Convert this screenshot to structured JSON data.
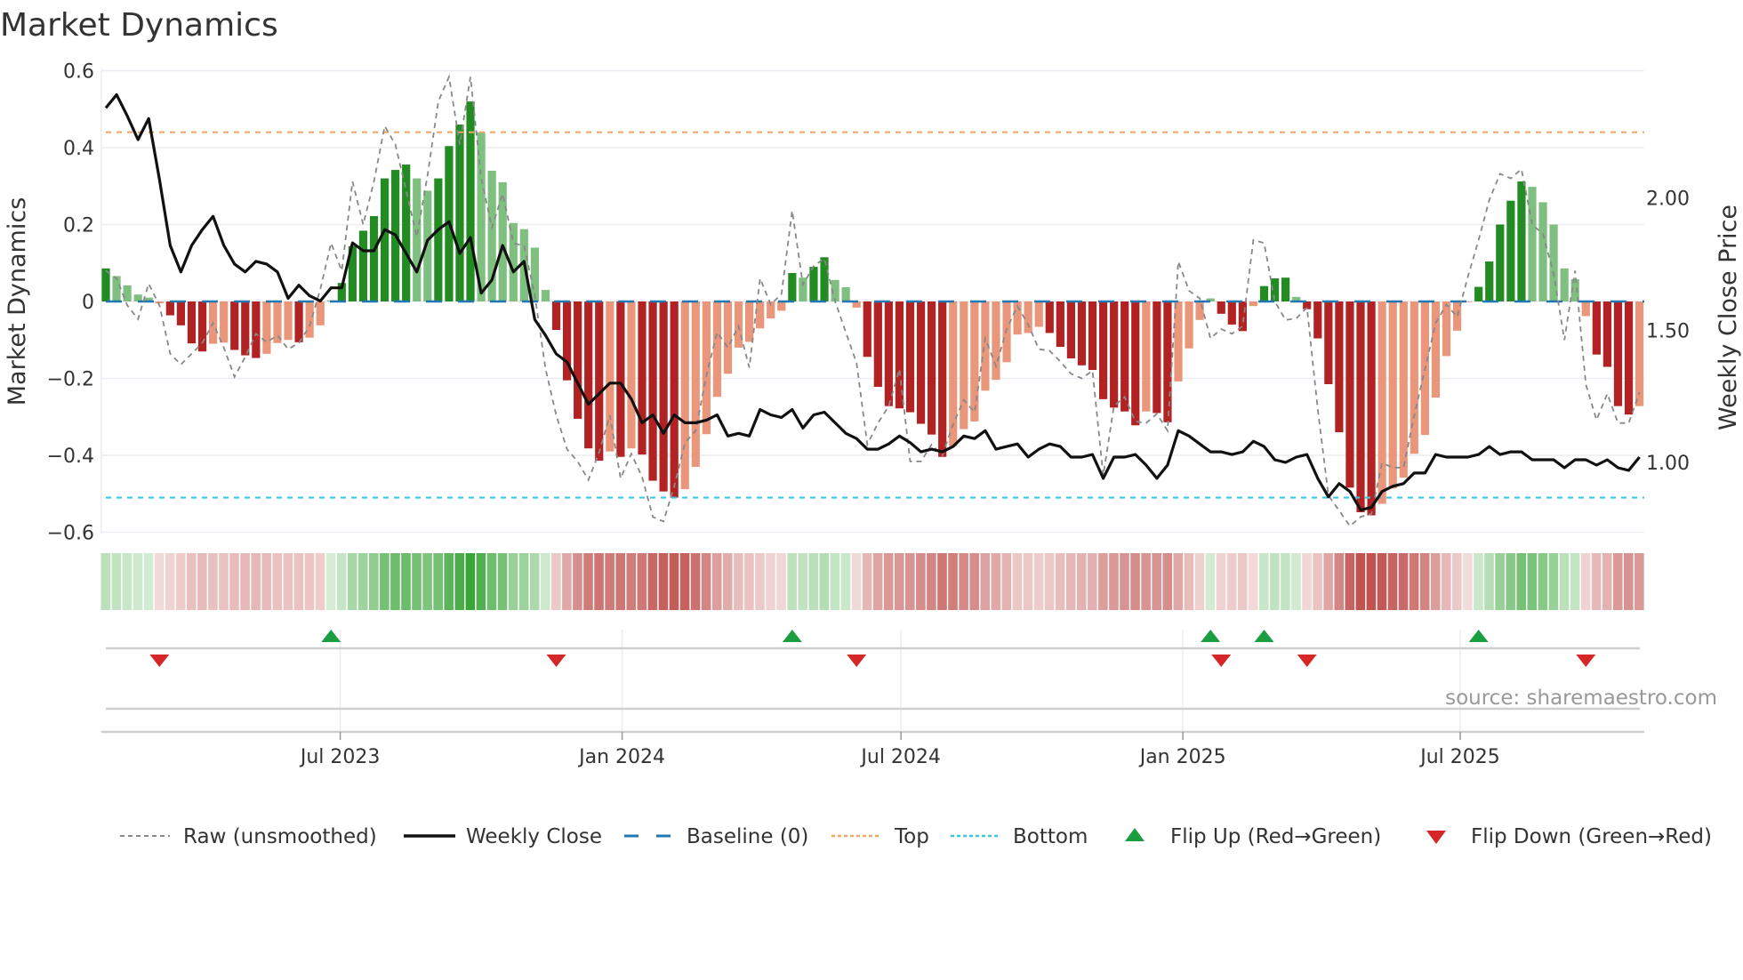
{
  "chart_data": {
    "type": "bar",
    "title": "Market Dynamics",
    "ylabel": "Market Dynamics",
    "y2label": "Weekly Close Price",
    "ylim": [
      -0.6,
      0.6
    ],
    "y2lim_visible_ticks": [
      1.0,
      1.5,
      2.0
    ],
    "yticks": [
      0.6,
      0.4,
      0.2,
      0,
      -0.2,
      -0.4,
      -0.6
    ],
    "ytick_labels": [
      "0.6",
      "0.4",
      "0.2",
      "0",
      "−0.2",
      "−0.4",
      "−0.6"
    ],
    "y2ticks": [
      2.0,
      1.5,
      1.0
    ],
    "y2tick_labels": [
      "2.00",
      "1.50",
      "1.00"
    ],
    "x_start": "2023-01-29",
    "x_interval_days": 7,
    "xticks": [
      "2023-07-01",
      "2024-01-01",
      "2024-07-01",
      "2025-01-01",
      "2025-07-01"
    ],
    "xtick_labels": [
      "Jul 2023",
      "Jan 2024",
      "Jul 2024",
      "Jan 2025",
      "Jul 2025"
    ],
    "grid": true,
    "top_level": 0.44,
    "bottom_level": -0.51,
    "baseline": 0,
    "colors": {
      "pos_strong": "#228b22",
      "pos_weak": "#7fbf7f",
      "neg_strong": "#b22222",
      "neg_weak": "#e9967a",
      "close": "#111111",
      "raw": "#888888",
      "baseline": "#1f77b4",
      "top": "#f0a868",
      "bottom": "#3cc8e0",
      "flip_up": "#1a9e3f",
      "flip_down": "#d62728",
      "heat_pos": "#2ca02c",
      "heat_neg": "#c0504d"
    },
    "series": [
      {
        "name": "Market Dynamics",
        "kind": "bar",
        "values": [
          0.086,
          0.066,
          0.042,
          0.018,
          0.01,
          -0.005,
          -0.036,
          -0.062,
          -0.109,
          -0.13,
          -0.11,
          -0.107,
          -0.126,
          -0.14,
          -0.147,
          -0.136,
          -0.108,
          -0.1,
          -0.106,
          -0.094,
          -0.062,
          0.003,
          0.048,
          0.144,
          0.184,
          0.222,
          0.32,
          0.342,
          0.356,
          0.32,
          0.288,
          0.32,
          0.404,
          0.46,
          0.52,
          0.44,
          0.34,
          0.31,
          0.204,
          0.188,
          0.14,
          0.03,
          -0.074,
          -0.205,
          -0.305,
          -0.382,
          -0.414,
          -0.39,
          -0.404,
          -0.382,
          -0.398,
          -0.466,
          -0.494,
          -0.51,
          -0.488,
          -0.43,
          -0.345,
          -0.248,
          -0.188,
          -0.12,
          -0.105,
          -0.07,
          -0.044,
          -0.024,
          0.074,
          0.062,
          0.09,
          0.115,
          0.056,
          0.037,
          -0.016,
          -0.144,
          -0.222,
          -0.272,
          -0.278,
          -0.288,
          -0.318,
          -0.346,
          -0.404,
          -0.376,
          -0.332,
          -0.312,
          -0.232,
          -0.204,
          -0.158,
          -0.086,
          -0.082,
          -0.066,
          -0.082,
          -0.118,
          -0.148,
          -0.166,
          -0.178,
          -0.254,
          -0.276,
          -0.286,
          -0.322,
          -0.286,
          -0.29,
          -0.314,
          -0.208,
          -0.122,
          -0.048,
          0.008,
          -0.032,
          -0.06,
          -0.077,
          -0.012,
          0.04,
          0.06,
          0.062,
          0.012,
          -0.02,
          -0.096,
          -0.215,
          -0.34,
          -0.484,
          -0.548,
          -0.556,
          -0.526,
          -0.486,
          -0.458,
          -0.396,
          -0.347,
          -0.25,
          -0.142,
          -0.076,
          -0.002,
          0.038,
          0.104,
          0.2,
          0.262,
          0.312,
          0.298,
          0.258,
          0.2,
          0.086,
          0.058,
          -0.038,
          -0.138,
          -0.17,
          -0.272,
          -0.294,
          -0.272
        ]
      },
      {
        "name": "Raw (unsmoothed)",
        "kind": "line",
        "values": [
          0.08,
          0.06,
          -0.01,
          -0.046,
          0.046,
          -0.01,
          -0.136,
          -0.164,
          -0.136,
          -0.108,
          -0.056,
          -0.12,
          -0.196,
          -0.144,
          -0.084,
          -0.106,
          -0.088,
          -0.124,
          -0.108,
          -0.064,
          0.032,
          0.152,
          0.08,
          0.312,
          0.2,
          0.312,
          0.456,
          0.408,
          0.288,
          0.168,
          0.328,
          0.52,
          0.584,
          0.408,
          0.584,
          0.32,
          0.192,
          0.28,
          0.152,
          0.144,
          0.016,
          -0.176,
          -0.296,
          -0.384,
          -0.416,
          -0.464,
          -0.392,
          -0.296,
          -0.46,
          -0.396,
          -0.456,
          -0.56,
          -0.572,
          -0.48,
          -0.368,
          -0.336,
          -0.192,
          -0.08,
          -0.12,
          -0.064,
          -0.172,
          0.06,
          -0.008,
          0.02,
          0.236,
          0.044,
          0.092,
          0.112,
          0,
          -0.08,
          -0.16,
          -0.372,
          -0.316,
          -0.272,
          -0.176,
          -0.416,
          -0.416,
          -0.372,
          -0.4,
          -0.32,
          -0.256,
          -0.288,
          -0.096,
          -0.168,
          -0.072,
          -0.012,
          -0.06,
          -0.124,
          -0.128,
          -0.156,
          -0.188,
          -0.2,
          -0.18,
          -0.452,
          -0.272,
          -0.248,
          -0.312,
          -0.316,
          -0.292,
          -0.336,
          0.104,
          0.028,
          0.008,
          -0.096,
          -0.072,
          -0.084,
          -0.064,
          0.16,
          0.152,
          0,
          -0.048,
          -0.044,
          -0.016,
          -0.28,
          -0.504,
          -0.544,
          -0.584,
          -0.56,
          -0.552,
          -0.42,
          -0.432,
          -0.432,
          -0.296,
          -0.176,
          -0.056,
          -0.008,
          -0.04,
          0.064,
          0.16,
          0.264,
          0.332,
          0.32,
          0.344,
          0.2,
          0.176,
          0.072,
          -0.1,
          0.08,
          -0.216,
          -0.308,
          -0.24,
          -0.316,
          -0.316,
          -0.236
        ]
      },
      {
        "name": "Weekly Close",
        "kind": "line",
        "axis": "right",
        "values": [
          2.34,
          2.39,
          2.31,
          2.22,
          2.3,
          2.07,
          1.82,
          1.72,
          1.82,
          1.88,
          1.93,
          1.82,
          1.75,
          1.72,
          1.76,
          1.75,
          1.72,
          1.62,
          1.67,
          1.63,
          1.61,
          1.66,
          1.66,
          1.83,
          1.8,
          1.8,
          1.88,
          1.86,
          1.79,
          1.72,
          1.84,
          1.88,
          1.91,
          1.79,
          1.85,
          1.64,
          1.69,
          1.82,
          1.72,
          1.76,
          1.54,
          1.48,
          1.41,
          1.38,
          1.3,
          1.22,
          1.26,
          1.3,
          1.3,
          1.24,
          1.15,
          1.18,
          1.11,
          1.18,
          1.15,
          1.15,
          1.16,
          1.18,
          1.1,
          1.11,
          1.1,
          1.2,
          1.18,
          1.17,
          1.2,
          1.13,
          1.18,
          1.19,
          1.15,
          1.11,
          1.09,
          1.05,
          1.05,
          1.07,
          1.1,
          1.075,
          1.04,
          1.05,
          1.04,
          1.06,
          1.1,
          1.09,
          1.12,
          1.05,
          1.06,
          1.07,
          1.02,
          1.05,
          1.07,
          1.06,
          1.02,
          1.02,
          1.03,
          0.94,
          1.02,
          1.02,
          1.03,
          0.99,
          0.94,
          0.99,
          1.12,
          1.1,
          1.07,
          1.04,
          1.04,
          1.03,
          1.04,
          1.08,
          1.06,
          1.01,
          1.0,
          1.02,
          1.03,
          0.94,
          0.87,
          0.92,
          0.89,
          0.82,
          0.83,
          0.89,
          0.91,
          0.92,
          0.96,
          0.96,
          1.03,
          1.02,
          1.02,
          1.02,
          1.03,
          1.06,
          1.03,
          1.04,
          1.04,
          1.01,
          1.01,
          1.01,
          0.98,
          1.01,
          1.01,
          0.99,
          1.01,
          0.98,
          0.97,
          1.02
        ]
      }
    ],
    "flip_up_dates": [
      "2023-06-25",
      "2024-04-21",
      "2025-01-19",
      "2025-02-23",
      "2025-07-13"
    ],
    "flip_down_dates": [
      "2023-03-05",
      "2023-11-19",
      "2024-06-02",
      "2025-01-26",
      "2025-03-23",
      "2025-09-21"
    ],
    "legend": {
      "placement": "bottom",
      "items": [
        {
          "label": "Raw (unsmoothed)",
          "symbol": "dotted-line"
        },
        {
          "label": "Weekly Close",
          "symbol": "solid-line"
        },
        {
          "label": "Baseline (0)",
          "symbol": "dashed-line"
        },
        {
          "label": "Top",
          "symbol": "dotted-line"
        },
        {
          "label": "Bottom",
          "symbol": "dotted-line"
        },
        {
          "label": "Flip Up (Red→Green)",
          "symbol": "triangle-up"
        },
        {
          "label": "Flip Down (Green→Red)",
          "symbol": "triangle-down"
        }
      ]
    },
    "annotation": "source: sharemaestro.com"
  }
}
